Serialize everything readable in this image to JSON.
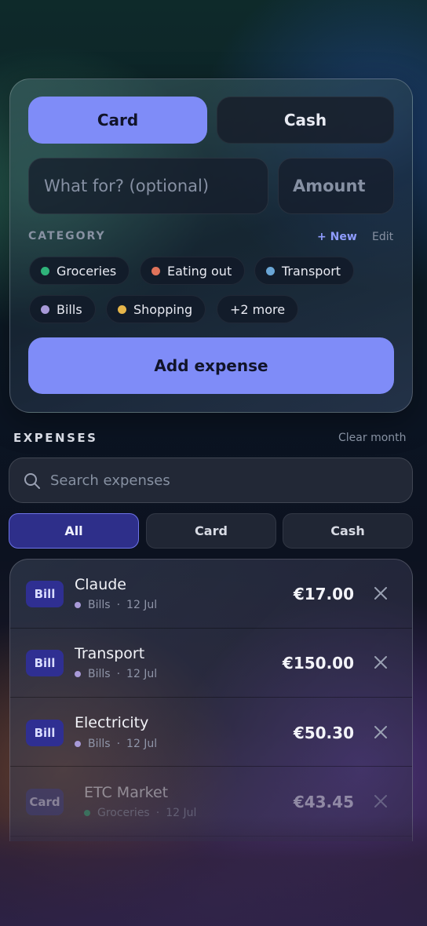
{
  "form": {
    "payment_tabs": [
      {
        "label": "Card",
        "active": true
      },
      {
        "label": "Cash",
        "active": false
      }
    ],
    "what_placeholder": "What for? (optional)",
    "amount_placeholder": "Amount",
    "category_heading": "CATEGORY",
    "new_label": "+ New",
    "edit_label": "Edit",
    "categories": [
      {
        "label": "Groceries",
        "color": "#2fb37a"
      },
      {
        "label": "Eating out",
        "color": "#e0735a"
      },
      {
        "label": "Transport",
        "color": "#6aa6d6"
      },
      {
        "label": "Bills",
        "color": "#a89ad8"
      },
      {
        "label": "Shopping",
        "color": "#e6b54a"
      }
    ],
    "more_label": "+2 more",
    "add_button": "Add expense"
  },
  "expenses": {
    "heading": "EXPENSES",
    "clear_label": "Clear month",
    "search_placeholder": "Search expenses",
    "filters": [
      {
        "label": "All",
        "active": true
      },
      {
        "label": "Card",
        "active": false
      },
      {
        "label": "Cash",
        "active": false
      }
    ],
    "items": [
      {
        "badge": "Bill",
        "title": "Claude",
        "category": "Bills",
        "category_color": "#a89ad8",
        "date": "12 Jul",
        "amount": "€17.00"
      },
      {
        "badge": "Bill",
        "title": "Transport",
        "category": "Bills",
        "category_color": "#a89ad8",
        "date": "12 Jul",
        "amount": "€150.00"
      },
      {
        "badge": "Bill",
        "title": "Electricity",
        "category": "Bills",
        "category_color": "#a89ad8",
        "date": "12 Jul",
        "amount": "€50.30"
      },
      {
        "badge": "Card",
        "title": "ETC Market",
        "category": "Groceries",
        "category_color": "#2fb37a",
        "date": "12 Jul",
        "amount": "€43.45"
      }
    ]
  },
  "colors": {
    "accent": "#7f8cf8",
    "badge_bg": "#2f2f92"
  },
  "icons": {
    "search": "search-icon",
    "remove": "close-icon"
  }
}
